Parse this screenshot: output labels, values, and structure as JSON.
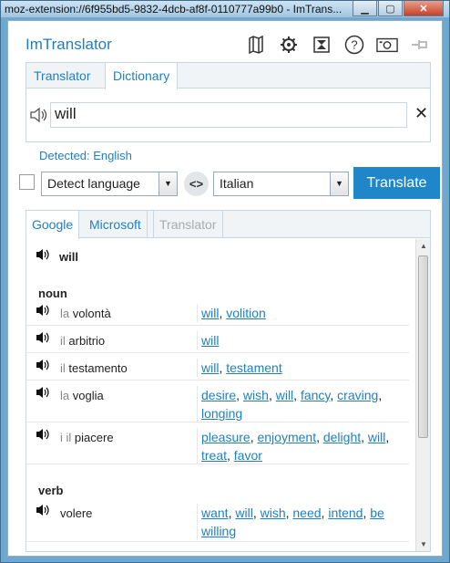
{
  "window": {
    "title": "moz-extension://6f955bd5-9832-4dcb-af8f-0110777a99b0 - ImTrans..."
  },
  "header": {
    "app_name": "ImTranslator",
    "icons": [
      "map-icon",
      "gear-icon",
      "hourglass-icon",
      "help-icon",
      "camera-icon",
      "pin-icon"
    ]
  },
  "mode_tabs": [
    "Translator",
    "Dictionary"
  ],
  "input": {
    "text": "will",
    "clear_label": "✕"
  },
  "detected": "Detected: English",
  "lang": {
    "source": "Detect language",
    "target": "Italian",
    "swap": "<>",
    "translate_label": "Translate"
  },
  "result_tabs": [
    "Google",
    "Microsoft",
    "Translator"
  ],
  "dictionary": {
    "headword": "will",
    "noun_label": "noun",
    "verb_label": "verb",
    "noun": [
      {
        "article": "la",
        "word": "volontà",
        "syns": [
          "will",
          "volition"
        ]
      },
      {
        "article": "il",
        "word": "arbitrio",
        "syns": [
          "will"
        ]
      },
      {
        "article": "il",
        "word": "testamento",
        "syns": [
          "will",
          "testament"
        ]
      },
      {
        "article": "la",
        "word": "voglia",
        "syns": [
          "desire",
          "wish",
          "will",
          "fancy",
          "craving",
          "longing"
        ]
      },
      {
        "article": "i il",
        "word": "piacere",
        "syns": [
          "pleasure",
          "enjoyment",
          "delight",
          "will",
          "treat",
          "favor"
        ]
      }
    ],
    "verb": [
      {
        "article": "",
        "word": "volere",
        "syns": [
          "want",
          "will",
          "wish",
          "need",
          "intend",
          "be willing"
        ]
      }
    ]
  }
}
